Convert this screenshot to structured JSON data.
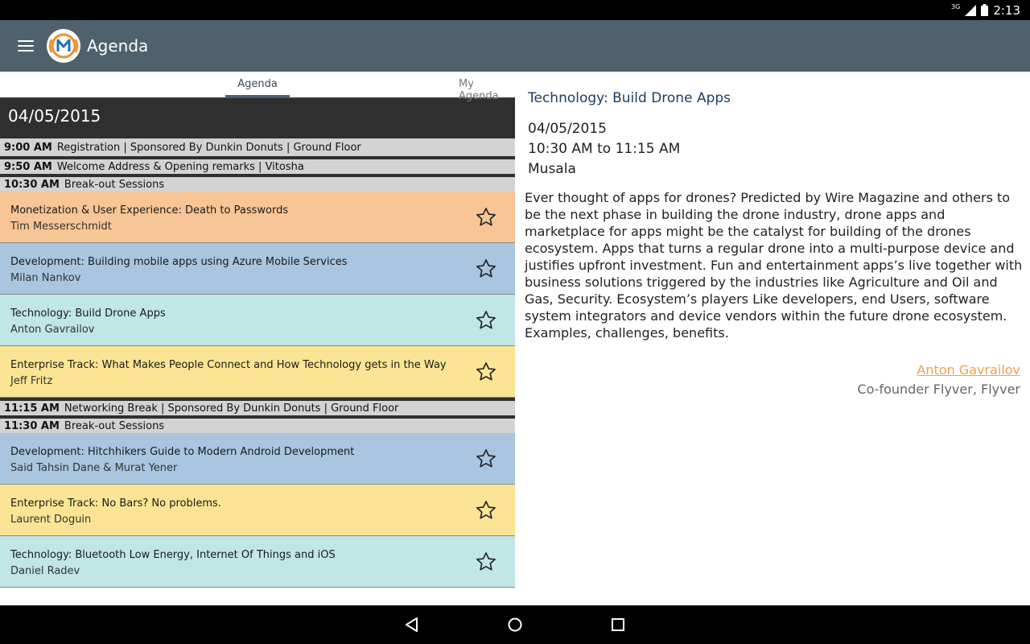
{
  "status_bar": {
    "network": "3G",
    "time": "2:13"
  },
  "app_bar": {
    "title": "Agenda"
  },
  "tabs": [
    {
      "label": "Agenda",
      "selected": true
    },
    {
      "label": "My Agenda",
      "selected": false
    }
  ],
  "agenda": {
    "date": "04/05/2015",
    "slots": [
      {
        "time": "9:00 AM",
        "desc": "Registration | Sponsored By Dunkin Donuts | Ground Floor"
      },
      {
        "time": "9:50 AM",
        "desc": "Welcome Address & Opening remarks | Vitosha"
      },
      {
        "time": "10:30 AM",
        "desc": "Break-out Sessions"
      },
      {
        "time": "11:15 AM",
        "desc": "Networking Break | Sponsored By Dunkin Donuts | Ground Floor"
      },
      {
        "time": "11:30 AM",
        "desc": "Break-out Sessions"
      }
    ],
    "sessions": [
      {
        "title": "Monetization & User Experience: Death to Passwords",
        "speaker": "Tim Messerschmidt"
      },
      {
        "title": "Development: Building mobile apps using Azure Mobile Services",
        "speaker": "Milan Nankov"
      },
      {
        "title": "Technology: Build Drone Apps",
        "speaker": "Anton Gavrailov"
      },
      {
        "title": "Enterprise Track: What Makes People Connect and How Technology gets in the Way",
        "speaker": "Jeff Fritz"
      },
      {
        "title": "Development: Hitchhikers Guide to Modern Android Development",
        "speaker": "Said Tahsin Dane & Murat Yener"
      },
      {
        "title": "Enterprise Track: No Bars? No problems.",
        "speaker": "Laurent Doguin"
      },
      {
        "title": "Technology: Bluetooth Low Energy, Internet Of Things and iOS",
        "speaker": "Daniel Radev"
      }
    ]
  },
  "detail": {
    "title": "Technology: Build Drone Apps",
    "date": "04/05/2015",
    "time_range": "10:30 AM to 11:15 AM",
    "room": "Musala",
    "description": "Ever thought of apps for drones? Predicted by Wire Magazine and others to be the next phase in building the drone industry, drone apps and marketplace for apps might be the catalyst for building of the drones ecosystem. Apps that turns a regular drone into a multi-purpose device and justifies upfront investment. Fun and entertainment apps’s live together with business solutions triggered by the industries like Agriculture and Oil and Gas, Security. Ecosystem’s players Like developers, end Users, software system integrators and device vendors within the future drone ecosystem. Examples, challenges, benefits.",
    "speaker_name": "Anton Gavrailov",
    "speaker_role": "Co-founder Flyver, Flyver"
  },
  "colors": {
    "app_bar": "#4e616d",
    "track_monetization": "#f7c596",
    "track_development": "#a9c5e0",
    "track_technology": "#c0e6e5",
    "track_enterprise": "#fbe594",
    "speaker_link": "#f0a050",
    "detail_title": "#1d3e63"
  },
  "icons": [
    "menu-icon",
    "app-logo",
    "star-outline-icon",
    "back-icon",
    "home-icon",
    "recents-icon"
  ]
}
